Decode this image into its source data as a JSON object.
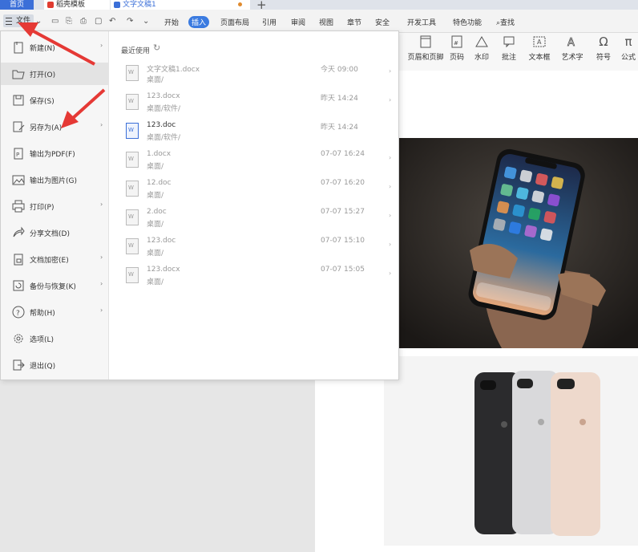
{
  "tabs": {
    "home": "首页",
    "template": "稻壳模板",
    "doc": "文字文稿1",
    "plus": "+"
  },
  "toolbar": {
    "file_label": "文件",
    "menus": [
      "开始",
      "插入",
      "页面布局",
      "引用",
      "审阅",
      "视图",
      "章节",
      "安全",
      "开发工具",
      "特色功能"
    ],
    "active_menu": "插入",
    "search_label": "查找"
  },
  "ribbon": [
    {
      "label": "页眉和页脚",
      "icon": "header-footer-icon"
    },
    {
      "label": "页码",
      "icon": "page-number-icon"
    },
    {
      "label": "水印",
      "icon": "watermark-icon"
    },
    {
      "label": "批注",
      "icon": "comment-icon"
    },
    {
      "label": "文本框",
      "icon": "textbox-icon"
    },
    {
      "label": "艺术字",
      "icon": "wordart-icon"
    },
    {
      "label": "符号",
      "icon": "symbol-icon"
    },
    {
      "label": "公式",
      "icon": "formula-icon"
    }
  ],
  "file_menu": {
    "items": [
      {
        "label": "新建(N)",
        "icon": "new-file-icon",
        "arrow": true
      },
      {
        "label": "打开(O)",
        "icon": "open-folder-icon",
        "arrow": false
      },
      {
        "label": "保存(S)",
        "icon": "save-icon",
        "arrow": false
      },
      {
        "label": "另存为(A)",
        "icon": "save-as-icon",
        "arrow": true
      },
      {
        "label": "输出为PDF(F)",
        "icon": "pdf-icon",
        "arrow": false
      },
      {
        "label": "输出为图片(G)",
        "icon": "image-export-icon",
        "arrow": false
      },
      {
        "label": "打印(P)",
        "icon": "print-icon",
        "arrow": true
      },
      {
        "label": "分享文档(D)",
        "icon": "share-icon",
        "arrow": false
      },
      {
        "label": "文档加密(E)",
        "icon": "encrypt-icon",
        "arrow": true
      },
      {
        "label": "备份与恢复(K)",
        "icon": "backup-icon",
        "arrow": true
      },
      {
        "label": "帮助(H)",
        "icon": "help-icon",
        "arrow": true
      },
      {
        "label": "选项(L)",
        "icon": "options-icon",
        "arrow": false
      },
      {
        "label": "退出(Q)",
        "icon": "exit-icon",
        "arrow": false
      }
    ],
    "recent_title": "最近使用",
    "recent": [
      {
        "name": "文字文稿1.docx",
        "path": "桌面/",
        "time": "今天 09:00",
        "dark": false
      },
      {
        "name": "123.docx",
        "path": "桌面/软件/",
        "time": "昨天 14:24",
        "dark": false
      },
      {
        "name": "123.doc",
        "path": "桌面/软件/",
        "time": "昨天 14:24",
        "dark": true
      },
      {
        "name": "1.docx",
        "path": "桌面/",
        "time": "07-07 16:24",
        "dark": false
      },
      {
        "name": "12.doc",
        "path": "桌面/",
        "time": "07-07 16:20",
        "dark": false
      },
      {
        "name": "2.doc",
        "path": "桌面/",
        "time": "07-07 15:27",
        "dark": false
      },
      {
        "name": "123.doc",
        "path": "桌面/",
        "time": "07-07 15:10",
        "dark": false
      },
      {
        "name": "123.docx",
        "path": "桌面/",
        "time": "07-07 15:05",
        "dark": false
      }
    ]
  },
  "colors": {
    "accent": "#3b6fd8",
    "arrow": "#e53935"
  }
}
